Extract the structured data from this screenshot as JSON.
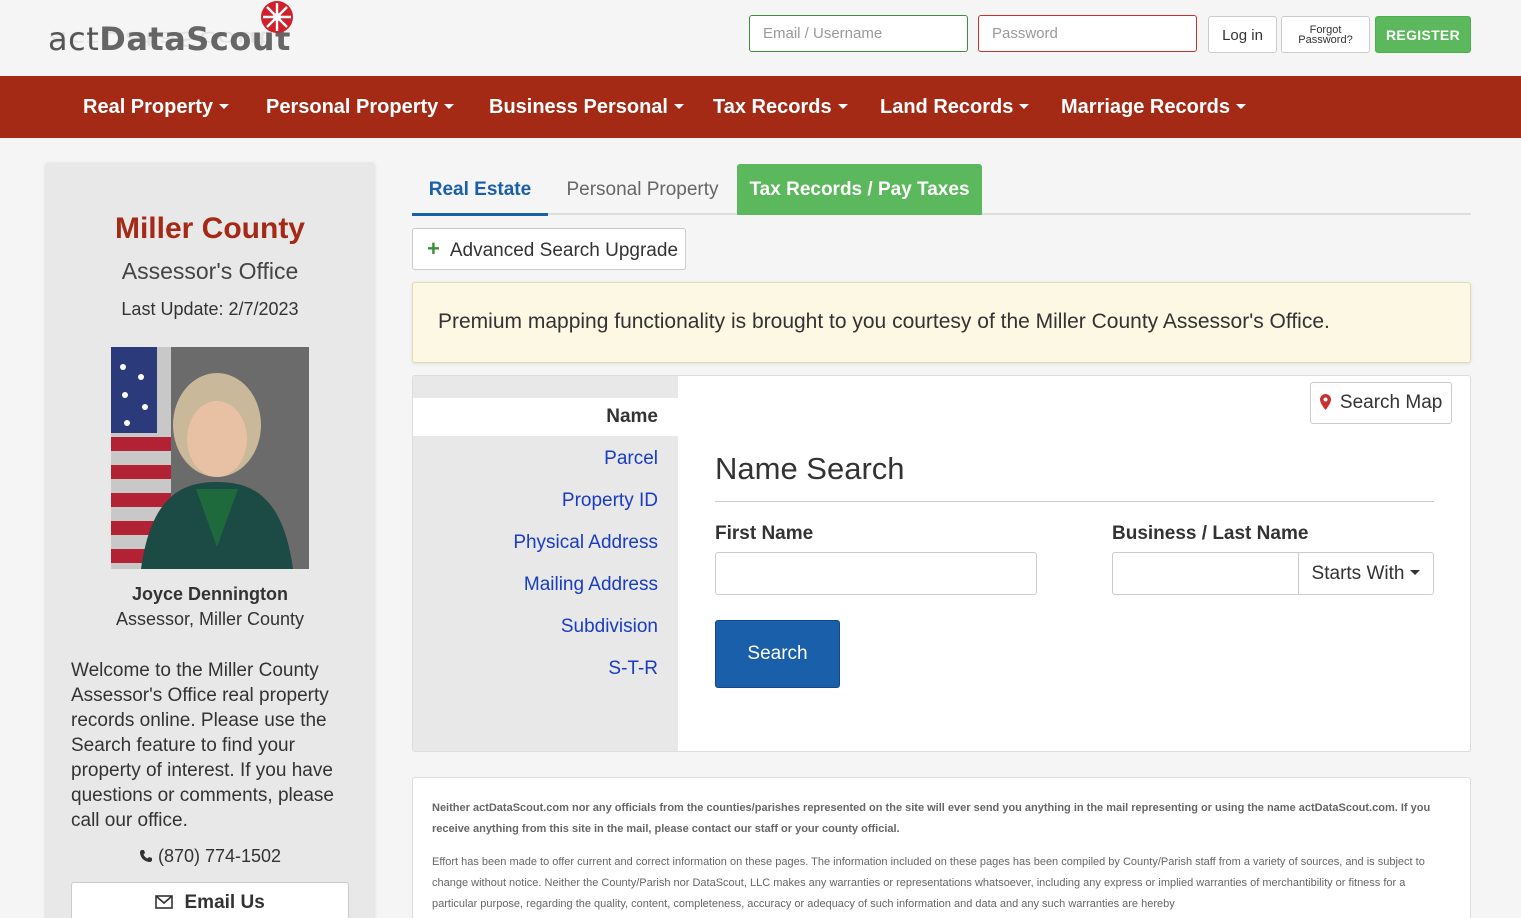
{
  "header": {
    "logo_plain": "act",
    "logo_bold": "DataScout",
    "logo_reflection": "actDataScout",
    "email_placeholder": "Email / Username",
    "password_placeholder": "Password",
    "login_label": "Log in",
    "forgot_line1": "Forgot",
    "forgot_line2": "Password?",
    "register_label": "REGISTER"
  },
  "nav": {
    "items": [
      {
        "label": "Real Property"
      },
      {
        "label": "Personal Property"
      },
      {
        "label": "Business Personal"
      },
      {
        "label": "Tax Records"
      },
      {
        "label": "Land Records"
      },
      {
        "label": "Marriage Records"
      }
    ]
  },
  "sidebar": {
    "county": "Miller County",
    "office": "Assessor's Office",
    "last_update": "Last Update: 2/7/2023",
    "official_name": "Joyce Dennington",
    "official_role": "Assessor, Miller County",
    "welcome": "Welcome to the Miller County Assessor's Office real property records online. Please use the Search feature to find your property of interest. If you have questions or comments, please call our office.",
    "phone": "(870) 774-1502",
    "email_label": "Email Us"
  },
  "tabs": [
    {
      "label": "Real Estate"
    },
    {
      "label": "Personal Property"
    },
    {
      "label": "Tax Records / Pay Taxes"
    }
  ],
  "advanced_search_label": "Advanced Search Upgrade",
  "notice": "Premium mapping functionality is brought to you courtesy of the Miller County Assessor's Office.",
  "search": {
    "side_items": [
      {
        "label": "Name"
      },
      {
        "label": "Parcel"
      },
      {
        "label": "Property ID"
      },
      {
        "label": "Physical Address"
      },
      {
        "label": "Mailing Address"
      },
      {
        "label": "Subdivision"
      },
      {
        "label": "S-T-R"
      }
    ],
    "map_label": "Search Map",
    "title": "Name Search",
    "first_name_label": "First Name",
    "last_name_label": "Business / Last Name",
    "starts_with_label": "Starts With",
    "search_button": "Search"
  },
  "disclaimer": {
    "warning": "Neither actDataScout.com nor any officials from the counties/parishes represented on the site will ever send you anything in the mail representing or using the name actDataScout.com. If you receive anything from this site in the mail, please contact our staff or your county official.",
    "body": "Effort has been made to offer current and correct information on these pages. The information included on these pages has been compiled by County/Parish staff from a variety of sources, and is subject to change without notice. Neither the County/Parish nor DataScout, LLC makes any warranties or representations whatsoever, including any express or implied warranties of merchantibility or fitness for a particular purpose, regarding the quality, content, completeness, accuracy or adequacy of such information and data and any such warranties are hereby"
  },
  "colors": {
    "nav_bg": "#a52a16",
    "accent_blue": "#1a5faa",
    "accent_green": "#5cb85c",
    "county_red": "#a52a16"
  }
}
